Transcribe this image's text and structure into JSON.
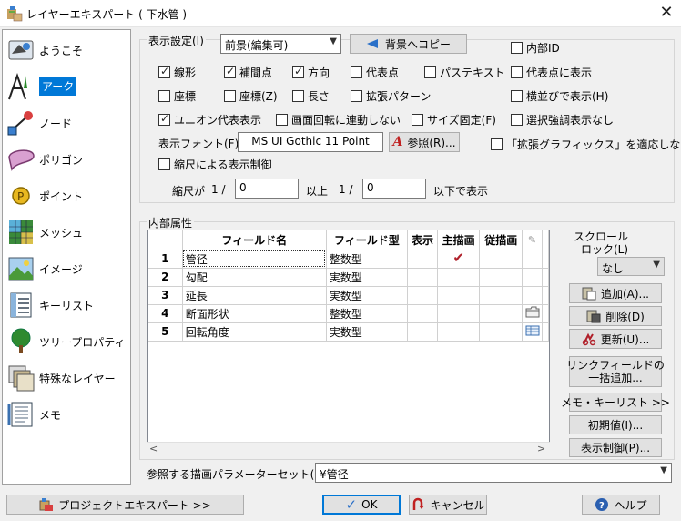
{
  "window": {
    "title": "レイヤーエキスパート ( 下水管 )",
    "close_symbol": "✕"
  },
  "nav": {
    "items": [
      {
        "label": "ようこそ",
        "icon": "welcome-icon"
      },
      {
        "label": "アーク",
        "icon": "arc-icon",
        "selected": true
      },
      {
        "label": "ノード",
        "icon": "node-icon"
      },
      {
        "label": "ポリゴン",
        "icon": "polygon-icon"
      },
      {
        "label": "ポイント",
        "icon": "point-icon"
      },
      {
        "label": "メッシュ",
        "icon": "mesh-icon"
      },
      {
        "label": "イメージ",
        "icon": "image-icon"
      },
      {
        "label": "キーリスト",
        "icon": "keylist-icon"
      },
      {
        "label": "ツリープロパティ",
        "icon": "tree-property-icon"
      },
      {
        "label": "特殊なレイヤー",
        "icon": "special-layer-icon"
      },
      {
        "label": "メモ",
        "icon": "memo-icon"
      }
    ]
  },
  "display": {
    "label": "表示設定(I)",
    "mode_select": "前景(編集可)",
    "copy_button": "背景へコピー",
    "internal_id": {
      "label": "内部ID",
      "checked": false
    },
    "row1": [
      {
        "label": "線形",
        "checked": true
      },
      {
        "label": "補間点",
        "checked": true
      },
      {
        "label": "方向",
        "checked": true
      },
      {
        "label": "代表点",
        "checked": false
      },
      {
        "label": "パステキスト",
        "checked": false
      }
    ],
    "show_at_representative": {
      "label": "代表点に表示",
      "checked": false
    },
    "row2": [
      {
        "label": "座標",
        "checked": false
      },
      {
        "label": "座標(Z)",
        "checked": false
      },
      {
        "label": "長さ",
        "checked": false
      },
      {
        "label": "拡張パターン",
        "checked": false
      }
    ],
    "horizontal": {
      "label": "横並びで表示(H)",
      "checked": false
    },
    "row3": [
      {
        "label": "ユニオン代表表示",
        "checked": true
      },
      {
        "label": "画面回転に連動しない",
        "checked": false
      },
      {
        "label": "サイズ固定(F)",
        "checked": false
      }
    ],
    "no_select_highlight": {
      "label": "選択強調表示なし",
      "checked": false
    },
    "font_label": "表示フォント(F)",
    "font_value": "MS UI Gothic 11 Point",
    "browse_button": "参照(R)...",
    "ext_graphics": {
      "label": "「拡張グラフィックス」を適応しない",
      "checked": false
    },
    "scale_control": {
      "label": "縮尺による表示制御",
      "checked": false
    },
    "scale": {
      "prefix": "縮尺が",
      "one_over_a": "1 /",
      "min": "0",
      "above": "以上",
      "one_over_b": "1 /",
      "max": "0",
      "below": "以下で表示"
    }
  },
  "attributes": {
    "label": "内部属性",
    "columns": [
      "",
      "フィールド名",
      "フィールド型",
      "表示",
      "主描画",
      "従描画"
    ],
    "rows": [
      {
        "num": "1",
        "name": "管径",
        "type": "整数型",
        "main_draw": true,
        "side_icon": false
      },
      {
        "num": "2",
        "name": "勾配",
        "type": "実数型",
        "main_draw": false,
        "side_icon": false
      },
      {
        "num": "3",
        "name": "延長",
        "type": "実数型",
        "main_draw": false,
        "side_icon": false
      },
      {
        "num": "4",
        "name": "断面形状",
        "type": "整数型",
        "main_draw": false,
        "side_icon": true
      },
      {
        "num": "5",
        "name": "回転角度",
        "type": "実数型",
        "main_draw": false,
        "side_icon": true
      }
    ],
    "scroll_lock_label_1": "スクロール",
    "scroll_lock_label_2": "ロック(L)",
    "scroll_lock_value": "なし",
    "add_button": "追加(A)...",
    "delete_button": "削除(D)",
    "update_button": "更新(U)...",
    "link_button_1": "リンクフィールドの",
    "link_button_2": "一括追加...",
    "memo_keylist_button": "メモ・キーリスト >>",
    "initial_button": "初期値(I)...",
    "display_control_button": "表示制御(P)..."
  },
  "param_set": {
    "label": "参照する描画パラメーターセット(P)",
    "value": "¥管径"
  },
  "footer": {
    "project_button": "プロジェクトエキスパート >>",
    "ok_button": "OK",
    "cancel_button": "キャンセル",
    "help_button": "ヘルプ"
  }
}
